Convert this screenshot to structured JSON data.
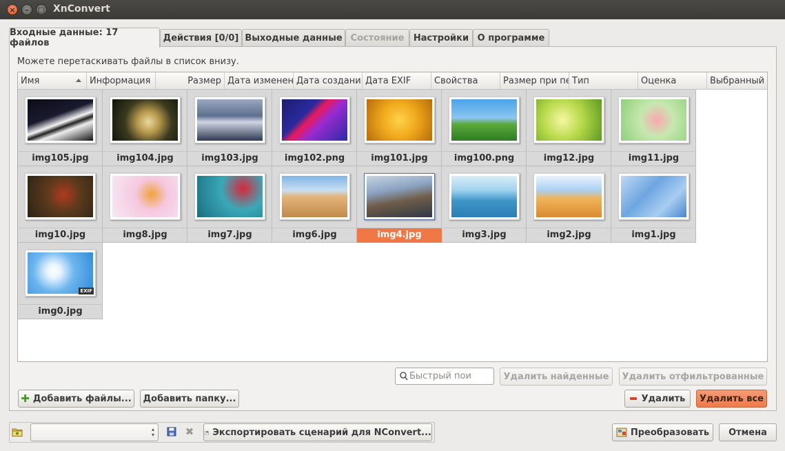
{
  "window": {
    "title": "XnConvert"
  },
  "tabs": [
    {
      "label": "Входные данные: 17 файлов",
      "state": "active"
    },
    {
      "label": "Действия [0/0]",
      "state": "normal"
    },
    {
      "label": "Выходные данные",
      "state": "normal"
    },
    {
      "label": "Состояние",
      "state": "disabled"
    },
    {
      "label": "Настройки",
      "state": "normal"
    },
    {
      "label": "О программе",
      "state": "normal"
    }
  ],
  "input_panel": {
    "hint": "Можете перетаскивать файлы в список внизу.",
    "columns": [
      "Имя",
      "Информация",
      "Размер",
      "Дата изменения",
      "Дата создания",
      "Дата EXIF",
      "Свойства",
      "Размер при печати",
      "Тип",
      "Оценка",
      "Выбранный"
    ],
    "sorted_column": "Имя",
    "files": [
      {
        "name": "img105.jpg",
        "selected": false,
        "exif": false
      },
      {
        "name": "img104.jpg",
        "selected": false,
        "exif": false
      },
      {
        "name": "img103.jpg",
        "selected": false,
        "exif": false
      },
      {
        "name": "img102.png",
        "selected": false,
        "exif": false
      },
      {
        "name": "img101.jpg",
        "selected": false,
        "exif": false
      },
      {
        "name": "img100.png",
        "selected": false,
        "exif": false
      },
      {
        "name": "img12.jpg",
        "selected": false,
        "exif": false
      },
      {
        "name": "img11.jpg",
        "selected": false,
        "exif": false
      },
      {
        "name": "img10.jpg",
        "selected": false,
        "exif": false
      },
      {
        "name": "img8.jpg",
        "selected": false,
        "exif": false
      },
      {
        "name": "img7.jpg",
        "selected": false,
        "exif": false
      },
      {
        "name": "img6.jpg",
        "selected": false,
        "exif": false
      },
      {
        "name": "img4.jpg",
        "selected": true,
        "exif": false
      },
      {
        "name": "img3.jpg",
        "selected": false,
        "exif": false
      },
      {
        "name": "img2.jpg",
        "selected": false,
        "exif": false
      },
      {
        "name": "img1.jpg",
        "selected": false,
        "exif": false
      },
      {
        "name": "img0.jpg",
        "selected": false,
        "exif": true,
        "badge": "EXIF"
      }
    ],
    "search_placeholder": "Быстрый пои",
    "remove_found_label": "Удалить найденные",
    "remove_filtered_label": "Удалить отфильтрованные",
    "add_files_label": "Добавить файлы...",
    "add_folder_label": "Добавить папку...",
    "remove_label": "Удалить",
    "remove_all_label": "Удалить все"
  },
  "footer": {
    "export_label": "Экспортировать сценарий для NConvert...",
    "convert_label": "Преобразовать",
    "cancel_label": "Отмена"
  },
  "colors": {
    "selection": "#f07746",
    "titlebar": "#3c3b37",
    "close_button": "#e0501f"
  }
}
